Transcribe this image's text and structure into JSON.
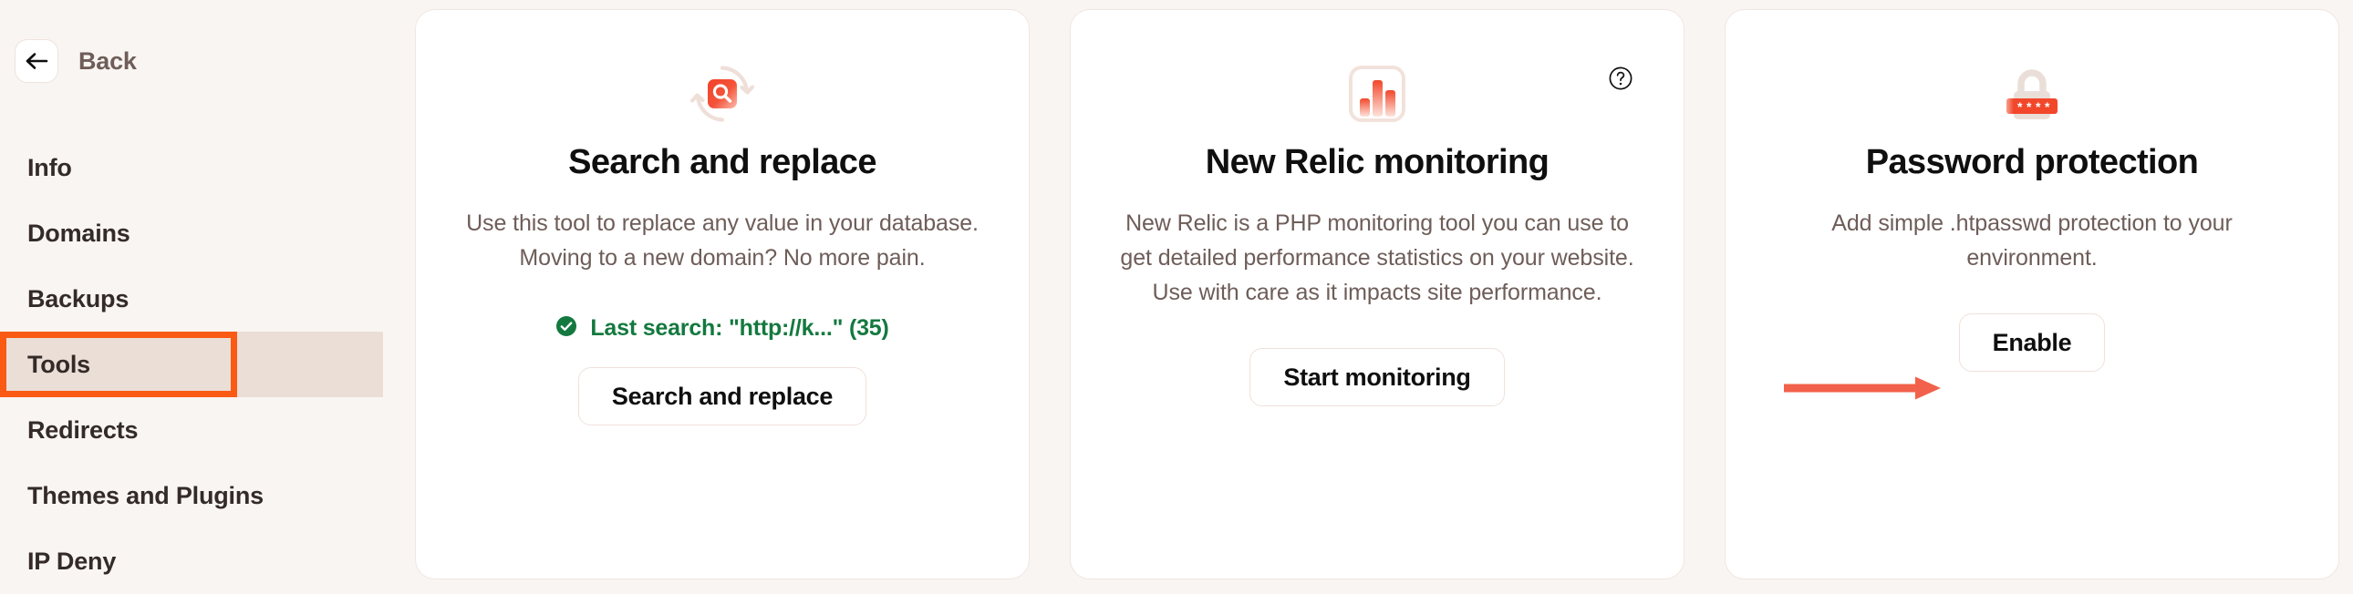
{
  "sidebar": {
    "back": {
      "label": "Back",
      "icon": "arrow-left-icon"
    },
    "items": [
      {
        "label": "Info",
        "active": false
      },
      {
        "label": "Domains",
        "active": false
      },
      {
        "label": "Backups",
        "active": false
      },
      {
        "label": "Tools",
        "active": true,
        "highlighted": true
      },
      {
        "label": "Redirects",
        "active": false
      },
      {
        "label": "Themes and Plugins",
        "active": false
      },
      {
        "label": "IP Deny",
        "active": false
      }
    ]
  },
  "cards": [
    {
      "id": "search-and-replace",
      "icon": "search-replace-icon",
      "title": "Search and replace",
      "description": "Use this tool to replace any value in your database. Moving to a new domain? No more pain.",
      "status": {
        "icon": "check-circle-icon",
        "text": "Last search: \"http://k...\" (35)",
        "color": "#14793F"
      },
      "button": "Search and replace"
    },
    {
      "id": "new-relic-monitoring",
      "icon": "bar-chart-icon",
      "help_icon": "question-mark-circle-icon",
      "title": "New Relic monitoring",
      "description": "New Relic is a PHP monitoring tool you can use to get detailed performance statistics on your website. Use with care as it impacts site performance.",
      "button": "Start monitoring"
    },
    {
      "id": "password-protection",
      "icon": "padlock-password-icon",
      "title": "Password protection",
      "description": "Add simple .htpasswd protection to your environment.",
      "button": "Enable",
      "annotation": {
        "icon": "red-arrow-right-annotation",
        "color": "#F2614B"
      }
    }
  ],
  "colors": {
    "page_background": "#F9F5F2",
    "card_background": "#FFFFFF",
    "accent_orange": "#FA5A14",
    "highlight_row": "#EADED7",
    "text_primary": "#100F0F",
    "text_secondary": "#6E5D58",
    "success_green": "#14793F",
    "annotation_red": "#F2614B"
  }
}
